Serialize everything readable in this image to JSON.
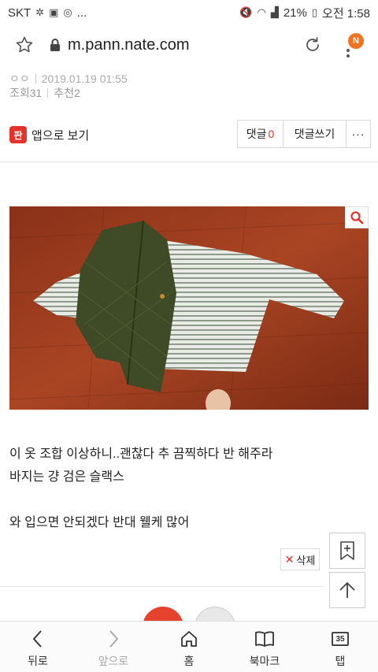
{
  "status_bar": {
    "carrier": "SKT",
    "more": "...",
    "battery": "21%",
    "time": "오전 1:58"
  },
  "browser": {
    "url": "m.pann.nate.com",
    "menu_badge": "N"
  },
  "post": {
    "author": "ㅇㅇ",
    "date": "2019.01.19 01:55",
    "views": "조회31",
    "recommends": "추천2"
  },
  "actions": {
    "app_logo": "판",
    "app_link": "앱으로 보기",
    "comments_label": "댓글",
    "comments_count": "0",
    "write_comment": "댓글쓰기",
    "more": "···"
  },
  "content": {
    "line1": "이 옷 조합 이상하니..괜찮다 추 끔찍하다 반 해주라",
    "line2": "바지는 걍 검은 슬랙스",
    "line3": "와 입으면 안되겠다 반대 웰케 많어",
    "delete": "삭제"
  },
  "bottom_nav": {
    "back": "뒤로",
    "forward": "앞으로",
    "home": "홈",
    "bookmarks": "북마크",
    "tabs": "탭",
    "tabs_count": "35"
  },
  "colors": {
    "accent_red": "#e5332a",
    "badge_orange": "#f0731f"
  }
}
